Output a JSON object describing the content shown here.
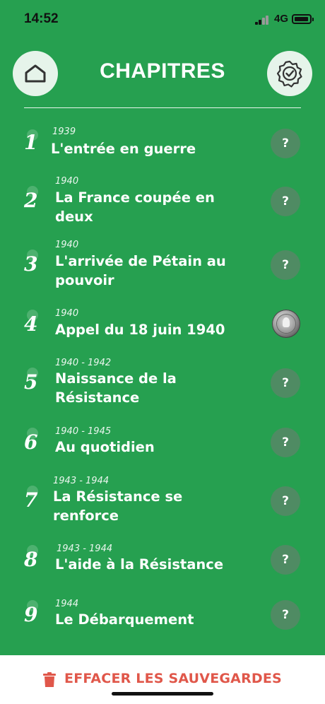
{
  "status_bar": {
    "time": "14:52",
    "network": "4G"
  },
  "header": {
    "title": "CHAPITRES"
  },
  "chapters": [
    {
      "number": "1",
      "date": "1939",
      "title": "L'entrée en guerre",
      "status": "?"
    },
    {
      "number": "2",
      "date": "1940",
      "title": "La France coupée en deux",
      "status": "?"
    },
    {
      "number": "3",
      "date": "1940",
      "title": "L'arrivée de Pétain au pouvoir",
      "status": "?"
    },
    {
      "number": "4",
      "date": "1940",
      "title": "Appel du 18 juin 1940",
      "status": ""
    },
    {
      "number": "5",
      "date": "1940 - 1942",
      "title": "Naissance de la Résistance",
      "status": "?"
    },
    {
      "number": "6",
      "date": "1940 - 1945",
      "title": "Au quotidien",
      "status": "?"
    },
    {
      "number": "7",
      "date": "1943 - 1944",
      "title": "La Résistance se renforce",
      "status": "?"
    },
    {
      "number": "8",
      "date": "1943 - 1944",
      "title": "L'aide à la Résistance",
      "status": "?"
    },
    {
      "number": "9",
      "date": "1944",
      "title": "Le Débarquement",
      "status": "?"
    }
  ],
  "footer": {
    "clear_label": "EFFACER LES SAUVEGARDES"
  },
  "colors": {
    "background": "#26a050",
    "accent_red": "#e0574a"
  },
  "icons": {
    "home": "home-icon",
    "settings": "badge-check-icon",
    "trash": "trash-icon"
  }
}
